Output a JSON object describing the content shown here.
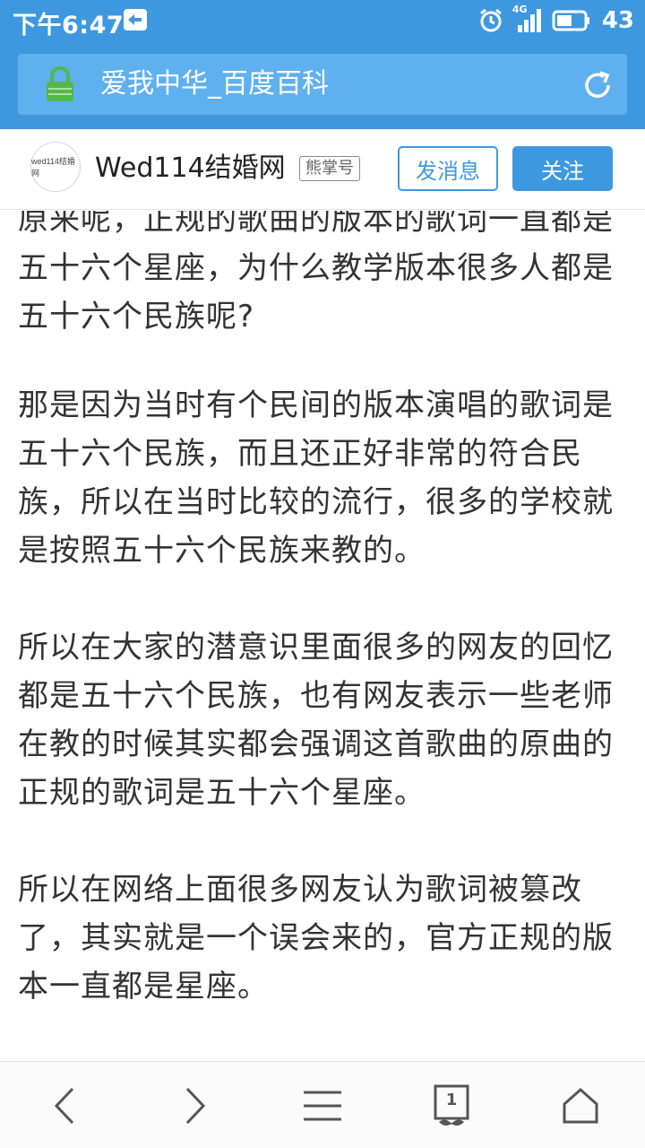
{
  "status_bar": {
    "time": "下午6:47",
    "network": "4G",
    "battery": "43"
  },
  "address_bar": {
    "title": "爱我中华_百度百科"
  },
  "account": {
    "avatar_text": "wed114结婚网",
    "name": "Wed114结婚网",
    "badge": "熊掌号",
    "message_button": "发消息",
    "follow_button": "关注"
  },
  "article": {
    "paragraphs": [
      "原来呢，正规的歌曲的版本的歌词一直都是五十六个星座，为什么教学版本很多人都是五十六个民族呢?",
      "那是因为当时有个民间的版本演唱的歌词是五十六个民族，而且还正好非常的符合民族，所以在当时比较的流行，很多的学校就是按照五十六个民族来教的。",
      "所以在大家的潜意识里面很多的网友的回忆都是五十六个民族，也有网友表示一些老师在教的时候其实都会强调这首歌曲的原曲的正规的歌词是五十六个星座。",
      "所以在网络上面很多网友认为歌词被篡改了，其实就是一个误会来的，官方正规的版本一直都是星座。"
    ]
  },
  "bottom_nav": {
    "tab_count": "1"
  },
  "colors": {
    "brand_blue": "#3d98e0",
    "lock_green": "#52b848"
  }
}
